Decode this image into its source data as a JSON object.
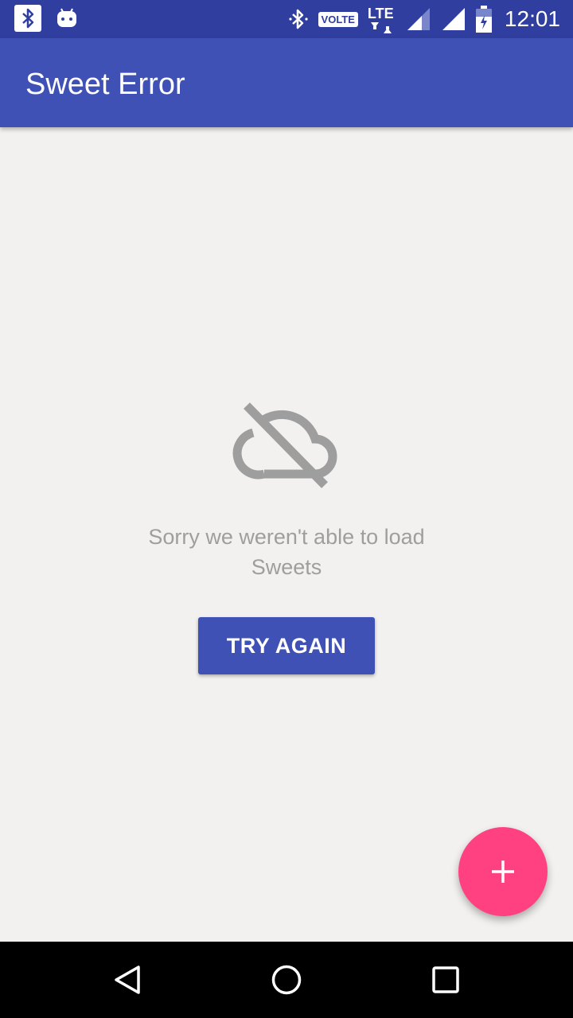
{
  "status_bar": {
    "left_icons": [
      "bluetooth-icon",
      "android-icon"
    ],
    "right_icons": [
      "bluetooth-icon",
      "volte-badge",
      "lte-icon",
      "signal-icon",
      "signal-icon",
      "battery-icon"
    ],
    "volte_label": "VOLTE",
    "network_label": "LTE",
    "time": "12:01",
    "background_color": "#303f9f"
  },
  "app_bar": {
    "title": "Sweet Error",
    "background_color": "#3f51b5"
  },
  "error": {
    "icon": "cloud-off-icon",
    "message": "Sorry we weren't able to load Sweets",
    "retry_label": "TRY AGAIN"
  },
  "fab": {
    "icon": "plus-icon",
    "color": "#ff4081"
  },
  "nav_bar": {
    "items": [
      "back-icon",
      "home-icon",
      "recents-icon"
    ]
  }
}
